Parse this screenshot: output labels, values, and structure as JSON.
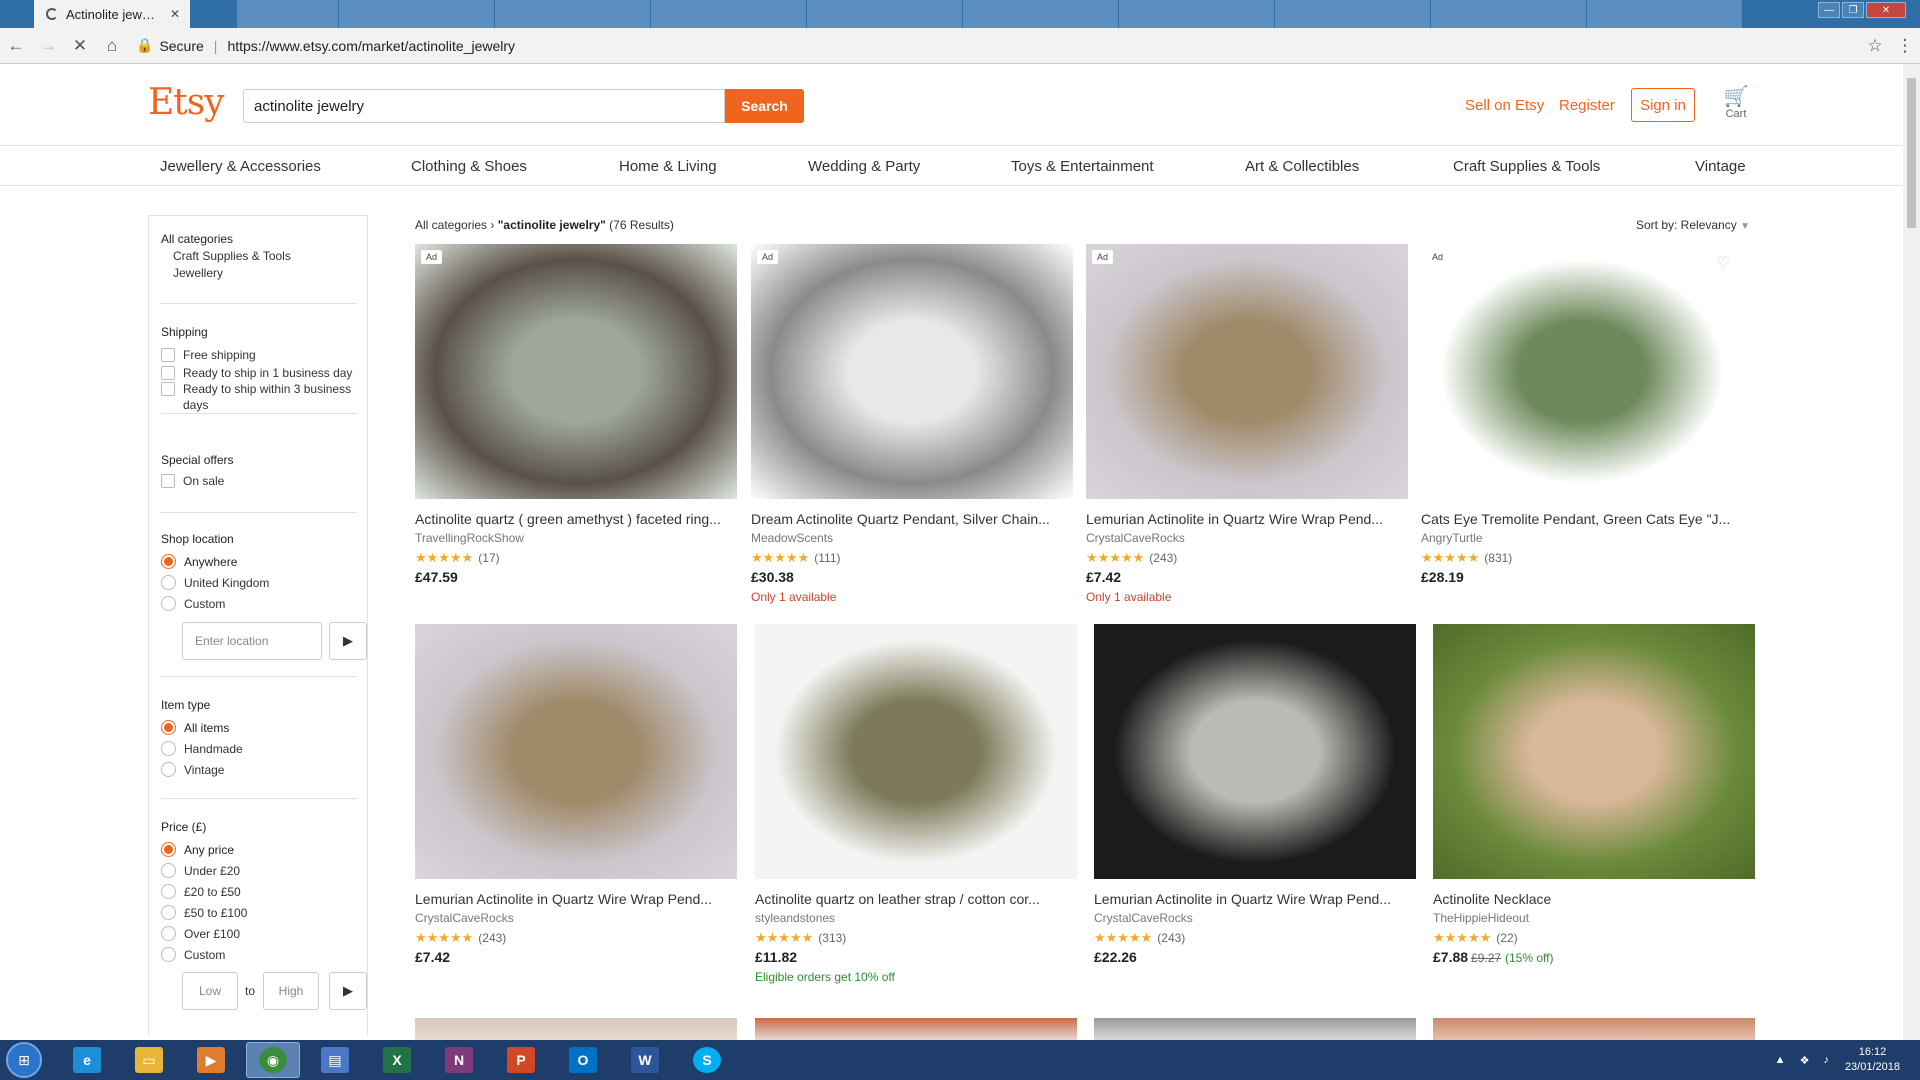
{
  "browser": {
    "active_tab_title": "Actinolite jewelry | Etsy",
    "tab_close": "✕",
    "secure_label": "Secure",
    "url": "https://www.etsy.com/market/actinolite_jewelry"
  },
  "header": {
    "logo": "Etsy",
    "search_value": "actinolite jewelry",
    "search_button": "Search",
    "sell_label": "Sell on Etsy",
    "register_label": "Register",
    "signin_label": "Sign in",
    "cart_label": "Cart"
  },
  "categories": [
    "Jewellery & Accessories",
    "Clothing & Shoes",
    "Home & Living",
    "Wedding & Party",
    "Toys & Entertainment",
    "Art & Collectibles",
    "Craft Supplies & Tools",
    "Vintage"
  ],
  "sidebar": {
    "all_categories": "All categories",
    "category_links": [
      "Craft Supplies & Tools",
      "Jewellery"
    ],
    "shipping": {
      "title": "Shipping",
      "options": [
        "Free shipping",
        "Ready to ship in 1 business day",
        "Ready to ship within 3 business days"
      ]
    },
    "special_offers": {
      "title": "Special offers",
      "options": [
        "On sale"
      ]
    },
    "shop_location": {
      "title": "Shop location",
      "options": [
        "Anywhere",
        "United Kingdom",
        "Custom"
      ],
      "selected": "Anywhere",
      "placeholder": "Enter location"
    },
    "item_type": {
      "title": "Item type",
      "options": [
        "All items",
        "Handmade",
        "Vintage"
      ],
      "selected": "All items"
    },
    "price": {
      "title": "Price (£)",
      "options": [
        "Any price",
        "Under £20",
        "£20 to £50",
        "£50 to £100",
        "Over £100",
        "Custom"
      ],
      "selected": "Any price",
      "low_placeholder": "Low",
      "to_label": "to",
      "high_placeholder": "High"
    }
  },
  "results": {
    "crumb_root": "All categories",
    "crumb_sep": "›",
    "query": "\"actinolite jewelry\"",
    "count": "(76 Results)",
    "sort_label": "Sort by: Relevancy",
    "ad_label": "Ad",
    "listings": [
      {
        "title": "Actinolite quartz ( green amethyst ) faceted ring...",
        "shop": "TravellingRockShow",
        "stars": "★★★★★",
        "reviews": "(17)",
        "price": "£47.59",
        "note": "",
        "ad": true,
        "colors": [
          "#5a5148",
          "#9fa79c",
          "#dfe6e0"
        ]
      },
      {
        "title": "Dream Actinolite Quartz Pendant, Silver Chain...",
        "shop": "MeadowScents",
        "stars": "★★★★★",
        "reviews": "(111)",
        "price": "£30.38",
        "note": "Only 1 available",
        "ad": true,
        "colors": [
          "#8a8a8a",
          "#e8e8e8",
          "#ffffff"
        ]
      },
      {
        "title": "Lemurian Actinolite in Quartz Wire Wrap Pend...",
        "shop": "CrystalCaveRocks",
        "stars": "★★★★★",
        "reviews": "(243)",
        "price": "£7.42",
        "note": "Only 1 available",
        "ad": true,
        "colors": [
          "#cbc6cc",
          "#a08a6a",
          "#d9d5da"
        ]
      },
      {
        "title": "Cats Eye Tremolite Pendant, Green Cats Eye \"J...",
        "shop": "AngryTurtle",
        "stars": "★★★★★",
        "reviews": "(831)",
        "price": "£28.19",
        "note": "",
        "ad": true,
        "heart": true,
        "colors": [
          "#ffffff",
          "#6e8a5c",
          "#ffffff"
        ]
      },
      {
        "title": "Lemurian Actinolite in Quartz Wire Wrap Pend...",
        "shop": "CrystalCaveRocks",
        "stars": "★★★★★",
        "reviews": "(243)",
        "price": "£7.42",
        "note": "",
        "ad": false,
        "colors": [
          "#cbc6cc",
          "#a08a6a",
          "#d9d5da"
        ]
      },
      {
        "title": "Actinolite quartz on leather strap / cotton cor...",
        "shop": "styleandstones",
        "stars": "★★★★★",
        "reviews": "(313)",
        "price": "£11.82",
        "note": "Eligible orders get 10% off",
        "note_green": true,
        "ad": false,
        "colors": [
          "#f4f4f4",
          "#7c7a58",
          "#f4f4f4"
        ]
      },
      {
        "title": "Lemurian Actinolite in Quartz Wire Wrap Pend...",
        "shop": "CrystalCaveRocks",
        "stars": "★★★★★",
        "reviews": "(243)",
        "price": "£22.26",
        "note": "",
        "ad": false,
        "colors": [
          "#1b1b1b",
          "#b8bcb4",
          "#1b1b1b"
        ]
      },
      {
        "title": "Actinolite Necklace",
        "shop": "TheHippieHideout",
        "stars": "★★★★★",
        "reviews": "(22)",
        "price": "£7.88",
        "old_price": "£9.27",
        "pct": "(15% off)",
        "note": "",
        "ad": false,
        "colors": [
          "#6b8a3a",
          "#d9b79a",
          "#4f6b2a"
        ]
      }
    ]
  },
  "taskbar": {
    "time": "16:12",
    "date": "23/01/2018"
  }
}
